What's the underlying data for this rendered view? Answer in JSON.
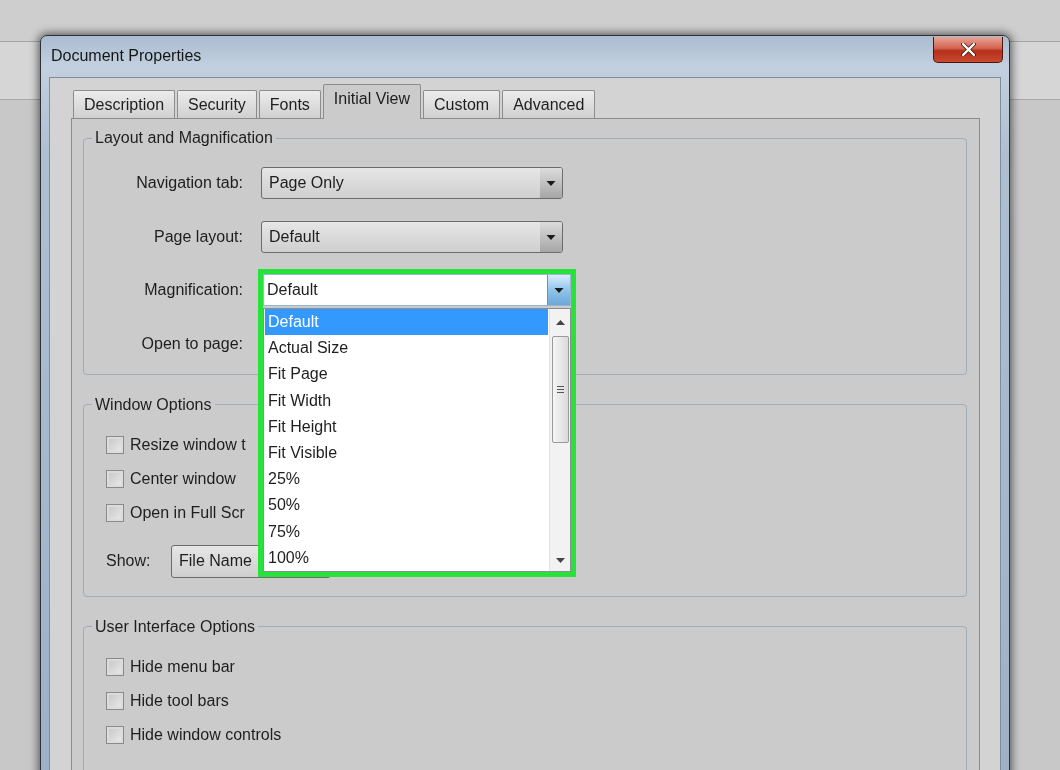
{
  "window": {
    "title": "Document Properties"
  },
  "tabs": [
    {
      "label": "Description",
      "selected": false
    },
    {
      "label": "Security",
      "selected": false
    },
    {
      "label": "Fonts",
      "selected": false
    },
    {
      "label": "Initial View",
      "selected": true
    },
    {
      "label": "Custom",
      "selected": false
    },
    {
      "label": "Advanced",
      "selected": false
    }
  ],
  "layout_and_magnification": {
    "title": "Layout and Magnification",
    "fields": [
      {
        "label": "Navigation tab:",
        "kind": "dropdown",
        "value": "Page Only",
        "open": false,
        "highlighted": false
      },
      {
        "label": "Page layout:",
        "kind": "dropdown",
        "value": "Default",
        "open": false,
        "highlighted": false
      },
      {
        "label": "Magnification:",
        "kind": "dropdown",
        "value": "Default",
        "open": true,
        "highlighted": true,
        "options": [
          {
            "label": "Default",
            "selected": true
          },
          {
            "label": "Actual Size",
            "selected": false
          },
          {
            "label": "Fit Page",
            "selected": false
          },
          {
            "label": "Fit Width",
            "selected": false
          },
          {
            "label": "Fit Height",
            "selected": false
          },
          {
            "label": "Fit Visible",
            "selected": false
          },
          {
            "label": "25%",
            "selected": false
          },
          {
            "label": "50%",
            "selected": false
          },
          {
            "label": "75%",
            "selected": false
          },
          {
            "label": "100%",
            "selected": false
          }
        ]
      },
      {
        "label": "Open to page:",
        "kind": "label"
      }
    ]
  },
  "window_options": {
    "title": "Window Options",
    "checkboxes": [
      {
        "label": "Resize window t",
        "checked": false
      },
      {
        "label": "Center window",
        "checked": false
      },
      {
        "label": "Open in Full Scr",
        "checked": false
      }
    ],
    "show": {
      "label": "Show:",
      "value": "File Name"
    }
  },
  "user_interface_options": {
    "title": "User Interface Options",
    "checkboxes": [
      {
        "label": "Hide menu bar",
        "checked": false
      },
      {
        "label": "Hide tool bars",
        "checked": false
      },
      {
        "label": "Hide window controls",
        "checked": false
      }
    ]
  }
}
